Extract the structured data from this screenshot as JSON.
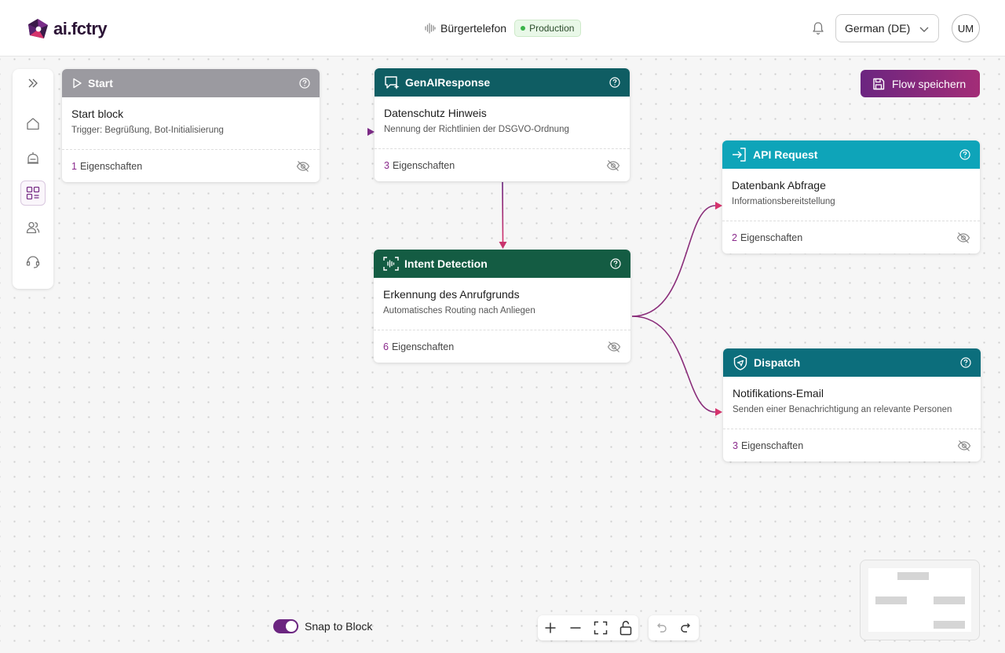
{
  "app": {
    "logo_text": "ai.fctry",
    "flow_name": "Bürgertelefon",
    "env_badge": "Production",
    "language": "German (DE)",
    "user_initials": "UM"
  },
  "toolbar": {
    "save_label": "Flow speichern",
    "snap_label": "Snap to Block",
    "snap_enabled": true
  },
  "sidebar": {
    "items": [
      {
        "icon": "expand-icon"
      },
      {
        "icon": "home-icon"
      },
      {
        "icon": "bot-icon"
      },
      {
        "icon": "flows-icon",
        "active": true
      },
      {
        "icon": "users-icon"
      },
      {
        "icon": "headset-icon"
      }
    ]
  },
  "nodes": {
    "start": {
      "type": "Start",
      "title": "Start block",
      "sub": "Trigger: Begrüßung, Bot-Initialisierung",
      "count": "1",
      "props_label": "Eigenschaften",
      "color": "#9b9aa0"
    },
    "genai": {
      "type": "GenAIResponse",
      "title": "Datenschutz Hinweis",
      "sub": "Nennung der Richtlinien der DSGVO-Ordnung",
      "count": "3",
      "props_label": "Eigenschaften",
      "color": "#0f5d63"
    },
    "intent": {
      "type": "Intent Detection",
      "title": "Erkennung des Anrufgrunds",
      "sub": "Automatisches Routing nach Anliegen",
      "count": "6",
      "props_label": "Eigenschaften",
      "color": "#145c43"
    },
    "api": {
      "type": "API Request",
      "title": "Datenbank Abfrage",
      "sub": "Informationsbereitstellung",
      "count": "2",
      "props_label": "Eigenschaften",
      "color": "#0ea4b9"
    },
    "dispatch": {
      "type": "Dispatch",
      "title": "Notifikations-Email",
      "sub": "Senden einer Benachrichtigung an relevante Personen",
      "count": "3",
      "props_label": "Eigenschaften",
      "color": "#0c6e7c"
    }
  },
  "colors": {
    "accent": "#6b2580",
    "edge_start": "#6b2580",
    "edge_end": "#d6336c"
  }
}
